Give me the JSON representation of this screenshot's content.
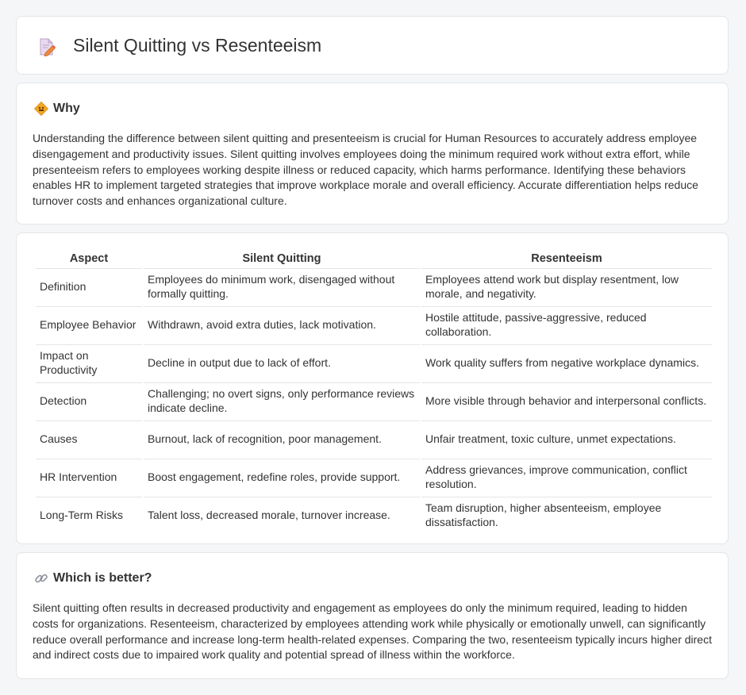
{
  "header": {
    "title": "Silent Quitting vs Resenteeism",
    "icon": "document-pencil-icon"
  },
  "why": {
    "heading": "Why",
    "icon": "diamond-sign-icon",
    "text": "Understanding the difference between silent quitting and presenteeism is crucial for Human Resources to accurately address employee disengagement and productivity issues. Silent quitting involves employees doing the minimum required work without extra effort, while presenteeism refers to employees working despite illness or reduced capacity, which harms performance. Identifying these behaviors enables HR to implement targeted strategies that improve workplace morale and overall efficiency. Accurate differentiation helps reduce turnover costs and enhances organizational culture."
  },
  "comparison": {
    "headers": [
      "Aspect",
      "Silent Quitting",
      "Resenteeism"
    ],
    "rows": [
      [
        "Definition",
        "Employees do minimum work, disengaged without formally quitting.",
        "Employees attend work but display resentment, low morale, and negativity."
      ],
      [
        "Employee Behavior",
        "Withdrawn, avoid extra duties, lack motivation.",
        "Hostile attitude, passive-aggressive, reduced collaboration."
      ],
      [
        "Impact on Productivity",
        "Decline in output due to lack of effort.",
        "Work quality suffers from negative workplace dynamics."
      ],
      [
        "Detection",
        "Challenging; no overt signs, only performance reviews indicate decline.",
        "More visible through behavior and interpersonal conflicts."
      ],
      [
        "Causes",
        "Burnout, lack of recognition, poor management.",
        "Unfair treatment, toxic culture, unmet expectations."
      ],
      [
        "HR Intervention",
        "Boost engagement, redefine roles, provide support.",
        "Address grievances, improve communication, conflict resolution."
      ],
      [
        "Long-Term Risks",
        "Talent loss, decreased morale, turnover increase.",
        "Team disruption, higher absenteeism, employee dissatisfaction."
      ]
    ]
  },
  "better": {
    "heading": "Which is better?",
    "icon": "link-icon",
    "text": "Silent quitting often results in decreased productivity and engagement as employees do only the minimum required, leading to hidden costs for organizations. Resenteeism, characterized by employees attending work while physically or emotionally unwell, can significantly reduce overall performance and increase long-term health-related expenses. Comparing the two, resenteeism typically incurs higher direct and indirect costs due to impaired work quality and potential spread of illness within the workforce."
  }
}
